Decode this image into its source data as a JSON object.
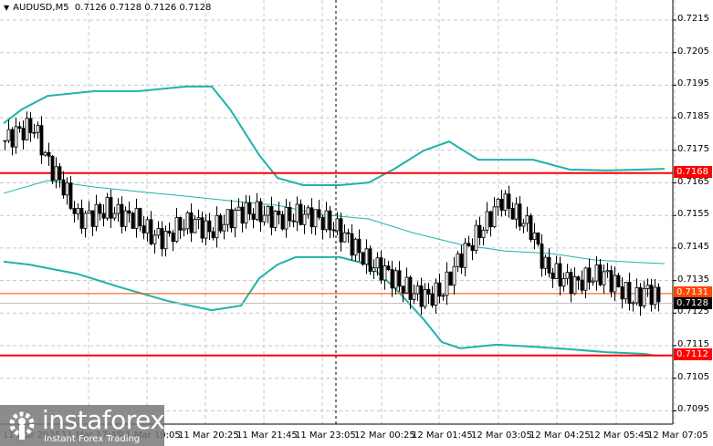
{
  "header": {
    "symbol": "AUDUSD,M5",
    "ohlc": "0.7126 0.7128 0.7126 0.7128"
  },
  "logo": {
    "name": "instaforex",
    "tagline": "Instant Forex Trading"
  },
  "time_labels": [
    "11 Mar 2025",
    "11 Mar 17:45",
    "11 Mar 19:05",
    "11 Mar 20:25",
    "11 Mar 21:45",
    "11 Mar 23:05",
    "12 Mar 00:25",
    "12 Mar 01:45",
    "12 Mar 03:05",
    "12 Mar 04:25",
    "12 Mar 05:45",
    "12 Mar 07:05"
  ],
  "price_labels": [
    "0.7215",
    "0.7205",
    "0.7195",
    "0.7185",
    "0.7175",
    "0.7165",
    "0.7155",
    "0.7145",
    "0.7135",
    "0.7125",
    "0.7115",
    "0.7105",
    "0.7095"
  ],
  "tags": {
    "resistance": "0.7168",
    "ask": "0.7131",
    "bid": "0.7128",
    "support": "0.7112"
  },
  "colors": {
    "level": "#ff0000",
    "band": "#20b2aa",
    "ask": "#ff4500",
    "bid": "#000000"
  },
  "chart_data": {
    "type": "candlestick",
    "price_range": [
      0.7092,
      0.722
    ],
    "bars_total": 180,
    "levels": [
      0.7168,
      0.7112
    ],
    "ask": 0.7131,
    "bid": 0.7128,
    "closes_every_4_bars": [
      0.7178,
      0.7181,
      0.7182,
      0.7171,
      0.7164,
      0.7154,
      0.7155,
      0.7157,
      0.7155,
      0.7154,
      0.7149,
      0.7148,
      0.7152,
      0.7153,
      0.715,
      0.7153,
      0.7156,
      0.7156,
      0.7155,
      0.7154,
      0.7155,
      0.7155,
      0.7153,
      0.715,
      0.7145,
      0.714,
      0.7138,
      0.7134,
      0.7131,
      0.713,
      0.7132,
      0.7141,
      0.7147,
      0.7153,
      0.716,
      0.7155,
      0.7151,
      0.7139,
      0.7136,
      0.7134,
      0.7136,
      0.7137,
      0.7133,
      0.7129,
      0.7132,
      0.7128
    ],
    "bollinger_upper": [
      [
        0,
        0.71833
      ],
      [
        5,
        0.71876
      ],
      [
        12,
        0.71917
      ],
      [
        25,
        0.71932
      ],
      [
        37,
        0.71932
      ],
      [
        50,
        0.71946
      ],
      [
        57,
        0.71946
      ],
      [
        62,
        0.71876
      ],
      [
        70,
        0.71735
      ],
      [
        75,
        0.71665
      ],
      [
        82,
        0.71643
      ],
      [
        92,
        0.71643
      ],
      [
        100,
        0.71651
      ],
      [
        107,
        0.71693
      ],
      [
        115,
        0.71749
      ],
      [
        122,
        0.71777
      ],
      [
        130,
        0.71721
      ],
      [
        137,
        0.71721
      ],
      [
        145,
        0.71721
      ],
      [
        155,
        0.71691
      ],
      [
        165,
        0.71688
      ],
      [
        175,
        0.71691
      ],
      [
        181,
        0.71693
      ]
    ],
    "bollinger_middle": [
      [
        0,
        0.71618
      ],
      [
        12,
        0.71657
      ],
      [
        25,
        0.71637
      ],
      [
        37,
        0.71623
      ],
      [
        50,
        0.71609
      ],
      [
        62,
        0.71595
      ],
      [
        75,
        0.71581
      ],
      [
        87,
        0.71553
      ],
      [
        100,
        0.71539
      ],
      [
        112,
        0.71497
      ],
      [
        125,
        0.71461
      ],
      [
        137,
        0.71441
      ],
      [
        150,
        0.71433
      ],
      [
        162,
        0.71413
      ],
      [
        175,
        0.71405
      ],
      [
        181,
        0.71402
      ]
    ],
    "bollinger_lower": [
      [
        0,
        0.71408
      ],
      [
        7,
        0.71399
      ],
      [
        20,
        0.71371
      ],
      [
        32,
        0.71329
      ],
      [
        45,
        0.71287
      ],
      [
        57,
        0.71259
      ],
      [
        65,
        0.71273
      ],
      [
        70,
        0.71357
      ],
      [
        75,
        0.71399
      ],
      [
        80,
        0.71422
      ],
      [
        92,
        0.71422
      ],
      [
        100,
        0.71399
      ],
      [
        107,
        0.71329
      ],
      [
        115,
        0.71231
      ],
      [
        120,
        0.71161
      ],
      [
        125,
        0.71142
      ],
      [
        135,
        0.71153
      ],
      [
        145,
        0.71147
      ],
      [
        155,
        0.71139
      ],
      [
        165,
        0.7113
      ],
      [
        175,
        0.71125
      ],
      [
        179,
        0.71119
      ]
    ]
  }
}
